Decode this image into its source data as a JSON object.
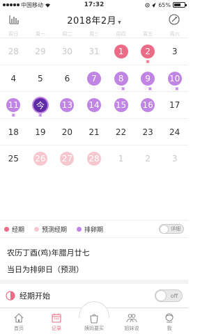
{
  "status_bar": {
    "carrier": "中国移动",
    "time": "17:32",
    "battery": "65%",
    "battery_level": 0.65
  },
  "header": {
    "month": "2018年2月"
  },
  "weekdays": [
    "周日",
    "周一",
    "周二",
    "周三",
    "周四",
    "周五",
    "周六"
  ],
  "calendar": {
    "weeks": [
      [
        {
          "day": "28",
          "state": "other"
        },
        {
          "day": "29",
          "state": "other"
        },
        {
          "day": "30",
          "state": "other"
        },
        {
          "day": "31",
          "state": "other"
        },
        {
          "day": "1",
          "state": "period"
        },
        {
          "day": "2",
          "state": "period",
          "marks": [
            "note"
          ]
        },
        {
          "day": "3",
          "state": "normal"
        }
      ],
      [
        {
          "day": "4",
          "state": "normal"
        },
        {
          "day": "5",
          "state": "normal"
        },
        {
          "day": "6",
          "state": "normal"
        },
        {
          "day": "7",
          "state": "ovulation",
          "marks": [
            "heart"
          ]
        },
        {
          "day": "8",
          "state": "ovulation",
          "marks": [
            "heart",
            "note"
          ]
        },
        {
          "day": "9",
          "state": "ovulation",
          "marks": [
            "heart",
            "note"
          ]
        },
        {
          "day": "10",
          "state": "ovulation",
          "marks": [
            "heart",
            "note"
          ]
        }
      ],
      [
        {
          "day": "11",
          "state": "ovulation",
          "marks": [
            "note"
          ]
        },
        {
          "day": "今",
          "state": "today",
          "marks": [
            "note"
          ]
        },
        {
          "day": "13",
          "state": "ovulation"
        },
        {
          "day": "14",
          "state": "ovulation"
        },
        {
          "day": "15",
          "state": "ovulation"
        },
        {
          "day": "16",
          "state": "ovulation"
        },
        {
          "day": "17",
          "state": "normal"
        }
      ],
      [
        {
          "day": "18",
          "state": "normal"
        },
        {
          "day": "19",
          "state": "normal"
        },
        {
          "day": "20",
          "state": "normal"
        },
        {
          "day": "21",
          "state": "normal"
        },
        {
          "day": "22",
          "state": "normal"
        },
        {
          "day": "23",
          "state": "normal"
        },
        {
          "day": "24",
          "state": "normal"
        }
      ],
      [
        {
          "day": "25",
          "state": "normal"
        },
        {
          "day": "26",
          "state": "predicted"
        },
        {
          "day": "27",
          "state": "predicted"
        },
        {
          "day": "28",
          "state": "predicted"
        },
        {
          "day": "1",
          "state": "other"
        },
        {
          "day": "2",
          "state": "other"
        },
        {
          "day": "3",
          "state": "other"
        }
      ]
    ]
  },
  "legend": {
    "items": [
      {
        "label": "经期",
        "color": "#ec6b86"
      },
      {
        "label": "预测经期",
        "color": "#f7c7d0"
      },
      {
        "label": "排卵期",
        "color": "#c084e4"
      }
    ],
    "toggle_label": "详细"
  },
  "info": {
    "lunar": "农历丁酉(鸡)年腊月廿七",
    "status": "当日为排卵日（预测）"
  },
  "period_start": {
    "label": "经期开始",
    "toggle": "off"
  },
  "tabs": [
    {
      "label": "首页",
      "icon": "home-icon"
    },
    {
      "label": "记录",
      "icon": "calendar-icon",
      "active": true
    },
    {
      "label": "姨妈要买",
      "icon": "shopping-bag-icon"
    },
    {
      "label": "姐妹说",
      "icon": "people-icon"
    },
    {
      "label": "我",
      "icon": "profile-icon"
    }
  ],
  "colors": {
    "period": "#ec6b86",
    "predicted": "#f7c7d0",
    "ovulation": "#c084e4",
    "today": "#5e2aa6"
  }
}
